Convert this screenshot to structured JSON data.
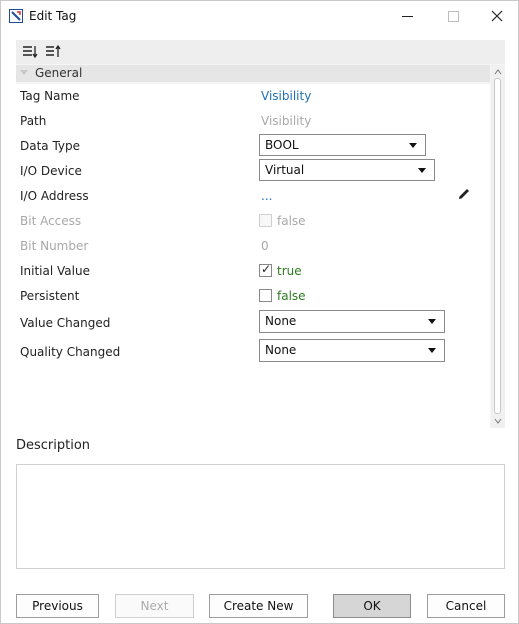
{
  "window": {
    "title": "Edit Tag"
  },
  "toolbar": {
    "sort_icon_1": "sort-categorized-icon",
    "sort_icon_2": "sort-alphabetical-icon"
  },
  "category": {
    "label": "General"
  },
  "properties": {
    "tag_name": {
      "label": "Tag Name",
      "value": "Visibility"
    },
    "path": {
      "label": "Path",
      "value": "Visibility"
    },
    "data_type": {
      "label": "Data Type",
      "value": "BOOL"
    },
    "io_device": {
      "label": "I/O Device",
      "value": "Virtual"
    },
    "io_address": {
      "label": "I/O Address",
      "value": "..."
    },
    "bit_access": {
      "label": "Bit Access",
      "value": "false",
      "checked": false
    },
    "bit_number": {
      "label": "Bit Number",
      "value": "0"
    },
    "initial_value": {
      "label": "Initial Value",
      "value": "true",
      "checked": true
    },
    "persistent": {
      "label": "Persistent",
      "value": "false",
      "checked": false
    },
    "value_changed": {
      "label": "Value Changed",
      "value": "None"
    },
    "quality_changed": {
      "label": "Quality Changed",
      "value": "None"
    }
  },
  "description": {
    "label": "Description",
    "value": ""
  },
  "buttons": {
    "previous": "Previous",
    "next": "Next",
    "create_new": "Create New",
    "ok": "OK",
    "cancel": "Cancel"
  },
  "colors": {
    "link": "#1e6fb5",
    "true_false": "#2d7a1f",
    "disabled_text": "#a8a8a8"
  }
}
